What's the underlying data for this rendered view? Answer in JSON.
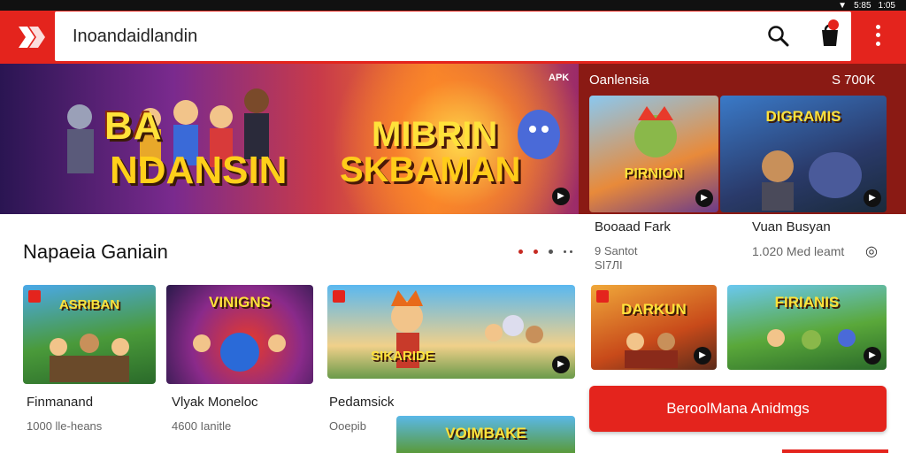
{
  "statusbar": {
    "time": "1:05",
    "carrier": "5:85"
  },
  "search": {
    "value": "Inoandaidlandin"
  },
  "header": {
    "notifications_badge": ""
  },
  "banner": {
    "title_left_1": "BA",
    "title_left_2": "NDANSIN",
    "title_right_1": "MIBRIN",
    "title_right_2": "SKBAMAN",
    "tag": "APK"
  },
  "side_panel": {
    "title": "Oanlensia",
    "count": "S 700K",
    "cards": [
      {
        "art": "PIRNION",
        "name": "Booaad Fark",
        "meta1": "9 Santot",
        "meta2": "SI7ЛI"
      },
      {
        "art": "DIGRAMIS",
        "name": "Vuan Busyan",
        "meta1": "1.020 Med leamt",
        "meta2": ""
      }
    ],
    "meta_icon": "◎"
  },
  "section": {
    "title": "Napaeia Ganiain"
  },
  "games": [
    {
      "art": "ASRIBAN",
      "name": "Finmanand",
      "meta": "1000 lle-heans"
    },
    {
      "art": "VINIGNS",
      "name": "Vlyak Moneloc",
      "meta": "4600 Ianitle"
    },
    {
      "art": "SIKARIDE",
      "name": "Pedamsick",
      "meta": "Ooepib"
    },
    {
      "art": "DARKUN",
      "name": "",
      "meta": ""
    },
    {
      "art": "FIRIANIS",
      "name": "",
      "meta": ""
    }
  ],
  "partial_banner": {
    "art": "VOIMBAKE"
  },
  "cta": {
    "label": "BeroolMana Anidmgs"
  },
  "colors": {
    "brand": "#e4241d",
    "panel": "#8a1a14"
  }
}
